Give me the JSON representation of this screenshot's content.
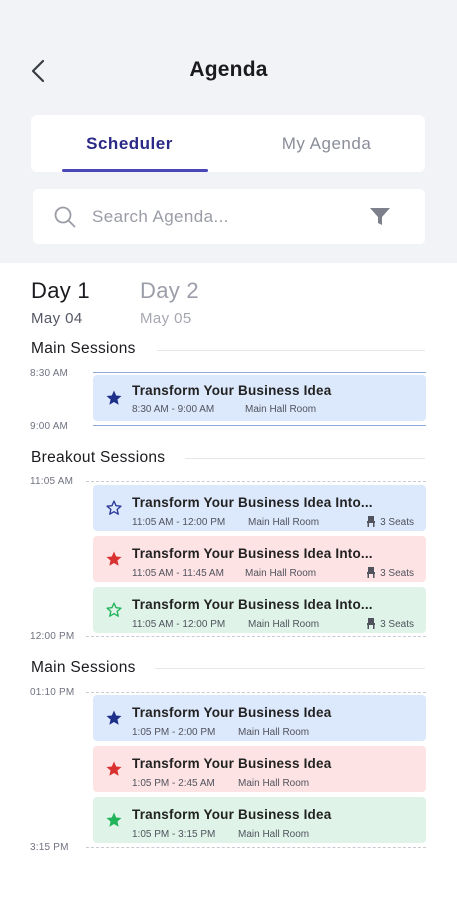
{
  "header": {
    "title": "Agenda"
  },
  "tabs": {
    "scheduler": "Scheduler",
    "my_agenda": "My Agenda"
  },
  "search": {
    "placeholder": "Search Agenda..."
  },
  "days": [
    {
      "name": "Day 1",
      "date": "May 04"
    },
    {
      "name": "Day 2",
      "date": "May 05"
    }
  ],
  "sections": [
    {
      "title": "Main Sessions"
    },
    {
      "title": "Breakout Sessions"
    },
    {
      "title": "Main Sessions"
    }
  ],
  "times": [
    "8:30 AM",
    "9:00 AM",
    "11:05 AM",
    "12:00 PM",
    "01:10 PM",
    "3:15 PM"
  ],
  "sessions": [
    {
      "title": "Transform Your Business Idea",
      "time": "8:30 AM - 9:00 AM",
      "room": "Main Hall Room",
      "seats": "",
      "star": "filled",
      "color": "#1e2f8a"
    },
    {
      "title": "Transform Your Business Idea Into...",
      "time": "11:05 AM - 12:00 PM",
      "room": "Main Hall Room",
      "seats": "3 Seats",
      "star": "outline",
      "color": "#2b3a9a"
    },
    {
      "title": "Transform Your Business Idea Into...",
      "time": "11:05 AM - 11:45 AM",
      "room": "Main Hall Room",
      "seats": "3 Seats",
      "star": "filled",
      "color": "#d93030"
    },
    {
      "title": "Transform Your Business Idea Into...",
      "time": "11:05 AM - 12:00 PM",
      "room": "Main Hall Room",
      "seats": "3 Seats",
      "star": "outline",
      "color": "#22b45a"
    },
    {
      "title": "Transform Your Business Idea",
      "time": "1:05 PM - 2:00 PM",
      "room": "Main Hall Room",
      "seats": "",
      "star": "filled",
      "color": "#1e2f8a"
    },
    {
      "title": "Transform Your Business Idea",
      "time": "1:05 PM - 2:45 AM",
      "room": "Main Hall Room",
      "seats": "",
      "star": "filled",
      "color": "#d93030"
    },
    {
      "title": "Transform Your Business Idea",
      "time": "1:05 PM - 3:15 PM",
      "room": "Main Hall Room",
      "seats": "",
      "star": "filled",
      "color": "#22b45a"
    }
  ],
  "colors": {
    "accent": "#4b47b6",
    "accent_text": "#2b2a86"
  }
}
